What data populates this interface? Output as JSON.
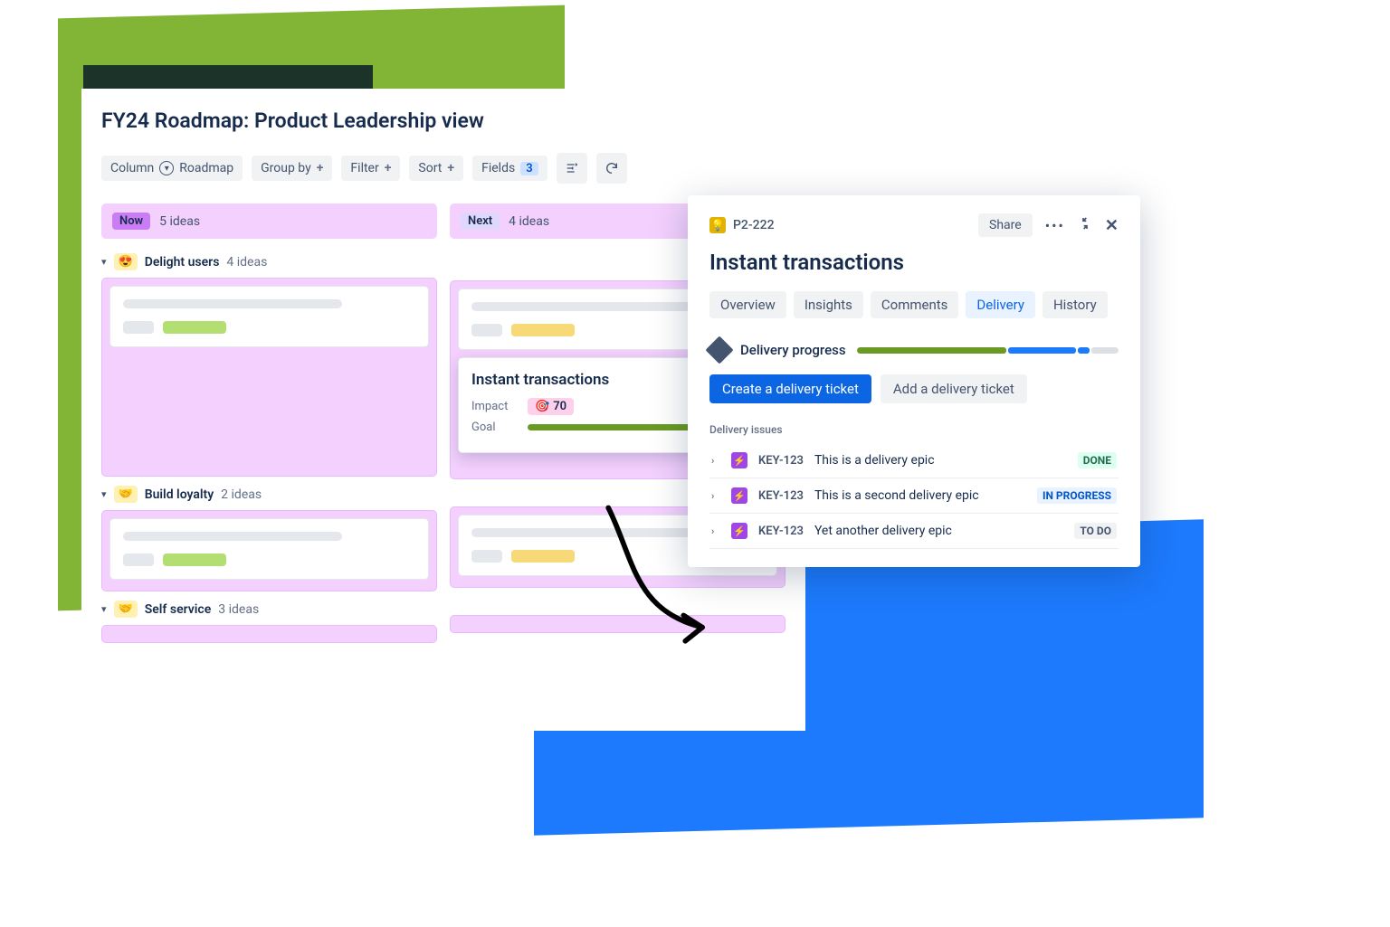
{
  "page": {
    "title": "FY24 Roadmap: Product Leadership view"
  },
  "toolbar": {
    "column_label": "Column",
    "column_value": "Roadmap",
    "groupby_label": "Group by",
    "filter_label": "Filter",
    "sort_label": "Sort",
    "fields_label": "Fields",
    "fields_count": "3"
  },
  "columns": {
    "now": {
      "badge": "Now",
      "count": "5 ideas"
    },
    "next": {
      "badge": "Next",
      "count": "4 ideas"
    }
  },
  "groups": {
    "delight": {
      "name": "Delight users",
      "count": "4 ideas",
      "emoji": "😍"
    },
    "loyalty": {
      "name": "Build loyalty",
      "count": "2 ideas",
      "emoji": "🤝"
    },
    "self": {
      "name": "Self service",
      "count": "3 ideas",
      "emoji": "🤝"
    }
  },
  "feature": {
    "title": "Instant transactions",
    "impact_label": "Impact",
    "impact_value": "70",
    "goal_label": "Goal"
  },
  "detail": {
    "key": "P2-222",
    "share": "Share",
    "title": "Instant transactions",
    "tabs": {
      "overview": "Overview",
      "insights": "Insights",
      "comments": "Comments",
      "delivery": "Delivery",
      "history": "History"
    },
    "progress_label": "Delivery progress",
    "create_btn": "Create a delivery ticket",
    "add_btn": "Add a delivery ticket",
    "issues_label": "Delivery issues",
    "issues": [
      {
        "key": "KEY-123",
        "summary": "This is a delivery epic",
        "status": "DONE"
      },
      {
        "key": "KEY-123",
        "summary": "This is a second delivery epic",
        "status": "IN PROGRESS"
      },
      {
        "key": "KEY-123",
        "summary": "Yet another delivery epic",
        "status": "TO DO"
      }
    ]
  }
}
